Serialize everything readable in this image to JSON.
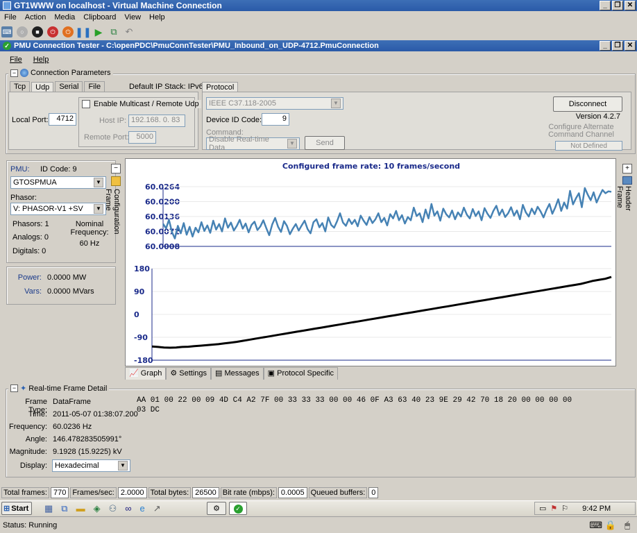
{
  "vm": {
    "title": "GT1WWW on localhost - Virtual Machine Connection",
    "menu": [
      "File",
      "Action",
      "Media",
      "Clipboard",
      "View",
      "Help"
    ],
    "toolbar_icons": [
      "ctrl-alt-del-icon",
      "start-icon",
      "turn-off-icon",
      "shutdown-icon",
      "reset-icon",
      "pause-icon",
      "play-icon",
      "snapshot-icon",
      "revert-icon"
    ]
  },
  "app": {
    "title": "PMU Connection Tester - C:\\openPDC\\PmuConnTester\\PMU_Inbound_on_UDP-4712.PmuConnection",
    "menu": [
      "File",
      "Help"
    ]
  },
  "conn": {
    "group_title": "Connection Parameters",
    "tabs": [
      "Tcp",
      "Udp",
      "Serial",
      "File"
    ],
    "default_ip_stack": "Default IP Stack: IPv6",
    "local_port_label": "Local Port:",
    "local_port_value": "4712",
    "multicast_label": "Enable Multicast / Remote Udp",
    "host_ip_label": "Host IP:",
    "host_ip_value": "192.168.   0.  83",
    "remote_port_label": "Remote Port:",
    "remote_port_value": "5000"
  },
  "protocol": {
    "tab": "Protocol",
    "protocol_value": "IEEE C37.118-2005",
    "device_id_label": "Device ID Code:",
    "device_id_value": "9",
    "command_label": "Command:",
    "command_value": "Disable Real-time Data",
    "send_label": "Send",
    "disconnect_label": "Disconnect",
    "version": "Version 4.2.7",
    "configure_alt": "Configure Alternate Command Channel",
    "not_defined": "Not Defined"
  },
  "pmu": {
    "pmu_label": "PMU:",
    "id_code": "ID Code:  9",
    "pmu_value": "GTOSPMUA",
    "phasor_label": "Phasor:",
    "phasor_value": "V: PHASOR-V1 +SV",
    "phasors": "Phasors:  1",
    "analogs": "Analogs:  0",
    "digitals": "Digitals:  0",
    "nominal_label": "Nominal Frequency:",
    "nominal_value": "60 Hz",
    "power_label": "Power:",
    "power_value": "0.0000 MW",
    "vars_label": "Vars:",
    "vars_value": "0.0000 MVars",
    "config_frame": "Configuration Frame",
    "header_frame": "Header Frame"
  },
  "chart_data": [
    {
      "type": "line",
      "title": "Configured frame rate: 10 frames/second",
      "yticks": [
        "60.0264",
        "60.0200",
        "60.0136",
        "60.0072",
        "60.0008"
      ],
      "ylim": [
        60.0008,
        60.0264
      ],
      "color": "#4682b4",
      "values": [
        60.0105,
        60.0085,
        60.0122,
        60.007,
        60.0042,
        60.0096,
        60.0064,
        60.0108,
        60.0058,
        60.0092,
        60.005,
        60.0088,
        60.0068,
        60.0112,
        60.0074,
        60.0098,
        60.0066,
        60.0118,
        60.008,
        60.0104,
        60.0072,
        60.0128,
        60.0088,
        60.011,
        60.0076,
        60.0096,
        60.0122,
        60.0084,
        60.0106,
        60.0068,
        60.01,
        60.0114,
        60.0078,
        60.0094,
        60.012,
        60.0086,
        60.0056,
        60.0102,
        60.013,
        60.0092,
        60.007,
        60.0116,
        60.0096,
        60.006,
        60.0084,
        60.0104,
        60.0076,
        60.0098,
        60.0118,
        60.0082,
        60.0064,
        60.0112,
        60.0124,
        60.009,
        60.0108,
        60.0072,
        60.0132,
        60.01,
        60.0088,
        60.0116,
        60.015,
        60.011,
        60.0096,
        60.0126,
        60.0104,
        60.0122,
        60.0094,
        60.014,
        60.0118,
        60.01,
        60.0134,
        60.0108,
        60.0124,
        60.015,
        60.0112,
        60.013,
        60.0098,
        60.0146,
        60.0128,
        60.016,
        60.012,
        60.0142,
        60.0106,
        60.0134,
        60.012,
        60.0174,
        60.0138,
        60.015,
        60.0112,
        60.0166,
        60.0128,
        60.019,
        60.014,
        60.0158,
        60.0118,
        60.017,
        60.0146,
        60.0132,
        60.0162,
        60.0124,
        60.0154,
        60.0136,
        60.0174,
        60.0144,
        60.0128,
        60.0168,
        60.0138,
        60.0158,
        60.012,
        60.0172,
        60.0148,
        60.013,
        60.016,
        60.0182,
        60.0142,
        60.0166,
        60.0134,
        60.015,
        60.0176,
        60.014,
        60.0162,
        60.0124,
        60.0186,
        60.0154,
        60.0136,
        60.017,
        60.0146,
        60.0178,
        60.0158,
        60.0132,
        60.0164,
        60.019,
        60.0148,
        60.0176,
        60.021,
        60.016,
        60.0196,
        60.017,
        60.0246,
        60.0188,
        60.0214,
        60.0236,
        60.0176,
        60.0258,
        60.023,
        60.0206,
        60.024,
        60.0196,
        60.0224,
        60.025,
        60.0236,
        60.0244,
        60.0242
      ]
    },
    {
      "type": "line",
      "yticks": [
        "180",
        "90",
        "0",
        "-90",
        "-180"
      ],
      "ylim": [
        -180,
        180
      ],
      "color": "#000000",
      "values": [
        -126,
        -128,
        -130,
        -131,
        -130,
        -128,
        -127,
        -125,
        -123,
        -121,
        -119,
        -117,
        -114,
        -111,
        -108,
        -104,
        -100,
        -96,
        -92,
        -88,
        -84,
        -80,
        -76,
        -72,
        -68,
        -64,
        -60,
        -56,
        -52,
        -48,
        -44,
        -40,
        -36,
        -32,
        -28,
        -24,
        -20,
        -16,
        -12,
        -8,
        -4,
        0,
        4,
        8,
        12,
        16,
        20,
        24,
        28,
        32,
        36,
        40,
        44,
        48,
        52,
        56,
        60,
        64,
        68,
        72,
        76,
        80,
        84,
        88,
        92,
        96,
        100,
        104,
        108,
        112,
        116,
        120,
        126,
        132,
        136,
        140,
        147
      ]
    }
  ],
  "graph_tabs": [
    "Graph",
    "Settings",
    "Messages",
    "Protocol Specific"
  ],
  "frame": {
    "group_title": "Real-time Frame Detail",
    "rows": [
      {
        "label": "Frame Type:",
        "value": "DataFrame"
      },
      {
        "label": "Time:",
        "value": "2011-05-07 01:38:07.200"
      },
      {
        "label": "Frequency:",
        "value": "60.0236 Hz"
      },
      {
        "label": "Angle:",
        "value": "146.478283505991°"
      },
      {
        "label": "Magnitude:",
        "value": "9.1928 (15.9225) kV"
      }
    ],
    "display_label": "Display:",
    "display_value": "Hexadecimal",
    "hex_line1": "AA 01 00 22 00 09 4D C4 A2 7F 00 33 33 33 00 00 46 0F A3 63 40 23 9E 29 42 70 18 20 00 00 00 00",
    "hex_line2": "03 DC"
  },
  "status": {
    "total_frames_label": "Total frames:",
    "total_frames": "770",
    "fps_label": "Frames/sec:",
    "fps": "2.0000",
    "bytes_label": "Total bytes:",
    "bytes": "26500",
    "bitrate_label": "Bit rate (mbps):",
    "bitrate": "0.0005",
    "queued_label": "Queued buffers:",
    "queued": "0"
  },
  "taskbar": {
    "start": "Start",
    "clock": "9:42 PM",
    "vm_status": "Status: Running"
  }
}
